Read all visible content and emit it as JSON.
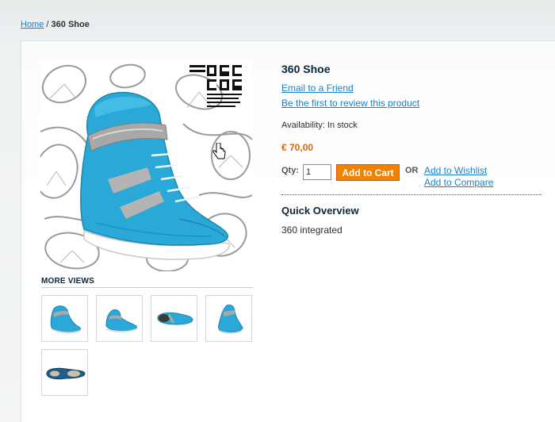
{
  "breadcrumb": {
    "home_label": "Home",
    "separator": "/",
    "current": "360 Shoe"
  },
  "product": {
    "name": "360 Shoe",
    "email_friend_label": "Email to a Friend",
    "review_label": "Be the first to review this product",
    "availability_label": "Availability:",
    "availability_value": "In stock",
    "price": "€ 70,00",
    "qty_label": "Qty:",
    "qty_value": "1",
    "add_to_cart_label": "Add to Cart",
    "or_label": "OR",
    "wishlist_label": "Add to Wishlist",
    "compare_label": "Add to Compare"
  },
  "overview": {
    "title": "Quick Overview",
    "text": "360 integrated"
  },
  "media": {
    "more_views_title": "MORE VIEWS",
    "logo_text": "CENTRO ITALIANO DEL CALZATO DI LUSSO",
    "thumbnails": [
      "side-view",
      "side-view-2",
      "top-view",
      "back-view",
      "sole-view"
    ]
  },
  "colors": {
    "link": "#1e7ec8",
    "price": "#d96708",
    "button": "#f18200",
    "shoe": "#2aa9d8"
  }
}
